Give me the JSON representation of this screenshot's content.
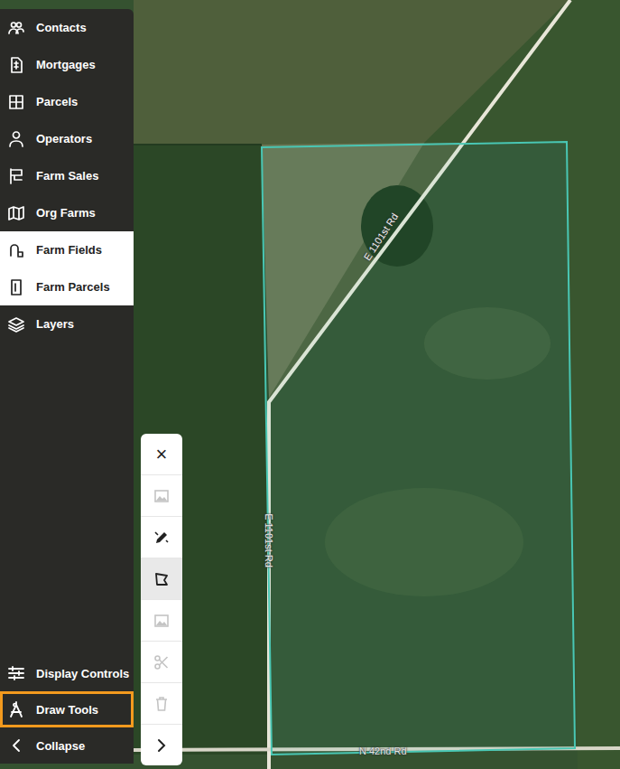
{
  "sidebar": {
    "items": [
      {
        "label": "Contacts",
        "selected": false
      },
      {
        "label": "Mortgages",
        "selected": false
      },
      {
        "label": "Parcels",
        "selected": false
      },
      {
        "label": "Operators",
        "selected": false
      },
      {
        "label": "Farm Sales",
        "selected": false
      },
      {
        "label": "Org Farms",
        "selected": false
      },
      {
        "label": "Farm Fields",
        "selected": true
      },
      {
        "label": "Farm Parcels",
        "selected": true
      },
      {
        "label": "Layers",
        "selected": false
      }
    ],
    "bottom": [
      {
        "label": "Display Controls",
        "active": false
      },
      {
        "label": "Draw Tools",
        "active": true
      },
      {
        "label": "Collapse",
        "active": false
      }
    ]
  },
  "toolbar": {
    "buttons": [
      {
        "kind": "close",
        "label": "×",
        "disabled": false,
        "selected": false
      },
      {
        "kind": "image",
        "label": "",
        "disabled": true,
        "selected": false
      },
      {
        "kind": "edit",
        "label": "",
        "disabled": false,
        "selected": false
      },
      {
        "kind": "polygon",
        "label": "",
        "disabled": false,
        "selected": true
      },
      {
        "kind": "image",
        "label": "",
        "disabled": true,
        "selected": false
      },
      {
        "kind": "cut",
        "label": "",
        "disabled": true,
        "selected": false
      },
      {
        "kind": "delete",
        "label": "",
        "disabled": true,
        "selected": false
      },
      {
        "kind": "next",
        "label": "",
        "disabled": false,
        "selected": false
      }
    ]
  },
  "map": {
    "labels": [
      {
        "text": "E 1101st Rd",
        "kind": "diagonal"
      },
      {
        "text": "E 1101st Rd",
        "kind": "vertical"
      },
      {
        "text": "N 42nd Rd",
        "kind": "horizontal"
      }
    ]
  }
}
